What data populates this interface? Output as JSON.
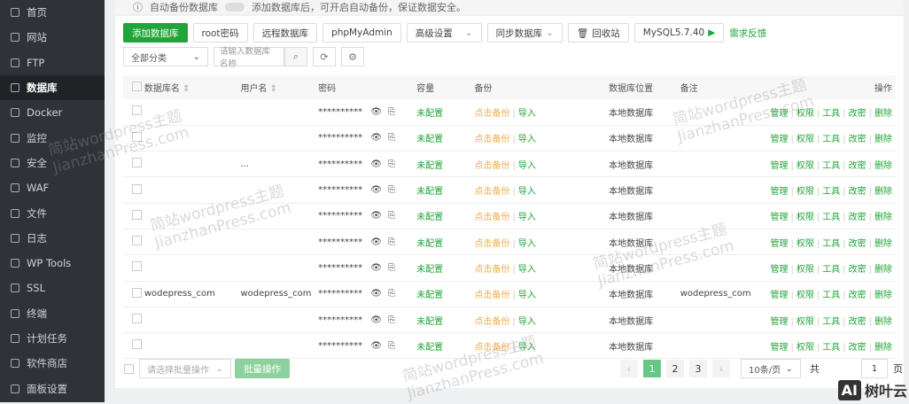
{
  "sidebar": {
    "items": [
      "首页",
      "网站",
      "FTP",
      "数据库",
      "Docker",
      "监控",
      "安全",
      "WAF",
      "文件",
      "日志",
      "WP Tools",
      "SSL",
      "终端",
      "计划任务",
      "软件商店",
      "面板设置"
    ],
    "active": 3
  },
  "notice": {
    "label": "自动备份数据库",
    "text": "添加数据库后，可开启自动备份，保证数据安全。"
  },
  "toolbar": {
    "add": "添加数据库",
    "root": "root密码",
    "remote": "远程数据库",
    "pma": "phpMyAdmin",
    "advanced": "高级设置",
    "sync": "同步数据库",
    "recycle": "回收站",
    "mysql": "MySQL5.7.40",
    "feedback": "需求反馈"
  },
  "filter": {
    "category": "全部分类",
    "search_placeholder": "请输入数据库名称"
  },
  "table": {
    "headers": [
      "数据库名",
      "用户名",
      "密码",
      "容量",
      "备份",
      "数据库位置",
      "备注",
      "操作"
    ],
    "rows": [
      {
        "name": "",
        "user": "",
        "note": ""
      },
      {
        "name": "",
        "user": "",
        "note": ""
      },
      {
        "name": "",
        "user": "...",
        "note": ""
      },
      {
        "name": "",
        "user": "",
        "note": ""
      },
      {
        "name": "",
        "user": "",
        "note": ""
      },
      {
        "name": "",
        "user": "",
        "note": ""
      },
      {
        "name": "",
        "user": "",
        "note": ""
      },
      {
        "name": "wodepress_com",
        "user": "wodepress_com",
        "note": "wodepress_com"
      },
      {
        "name": "",
        "user": "",
        "note": ""
      },
      {
        "name": "",
        "user": "",
        "note": ""
      }
    ],
    "password": "**********",
    "capacity": "未配置",
    "backup": "点击备份",
    "import": "导入",
    "location": "本地数据库",
    "ops": [
      "管理",
      "权限",
      "工具",
      "改密",
      "删除"
    ]
  },
  "footer": {
    "batch": "请选择批量操作",
    "batch_btn": "批量操作",
    "pages": [
      "1",
      "2",
      "3"
    ],
    "per_page": "10条/页",
    "total_prefix": "共",
    "page_input": "1",
    "page_suffix": "页"
  },
  "watermark": {
    "cn": "简站wordpress主题",
    "en": "JianzhanPress.com"
  },
  "logo": {
    "mark": "AI",
    "text": "树叶云"
  }
}
